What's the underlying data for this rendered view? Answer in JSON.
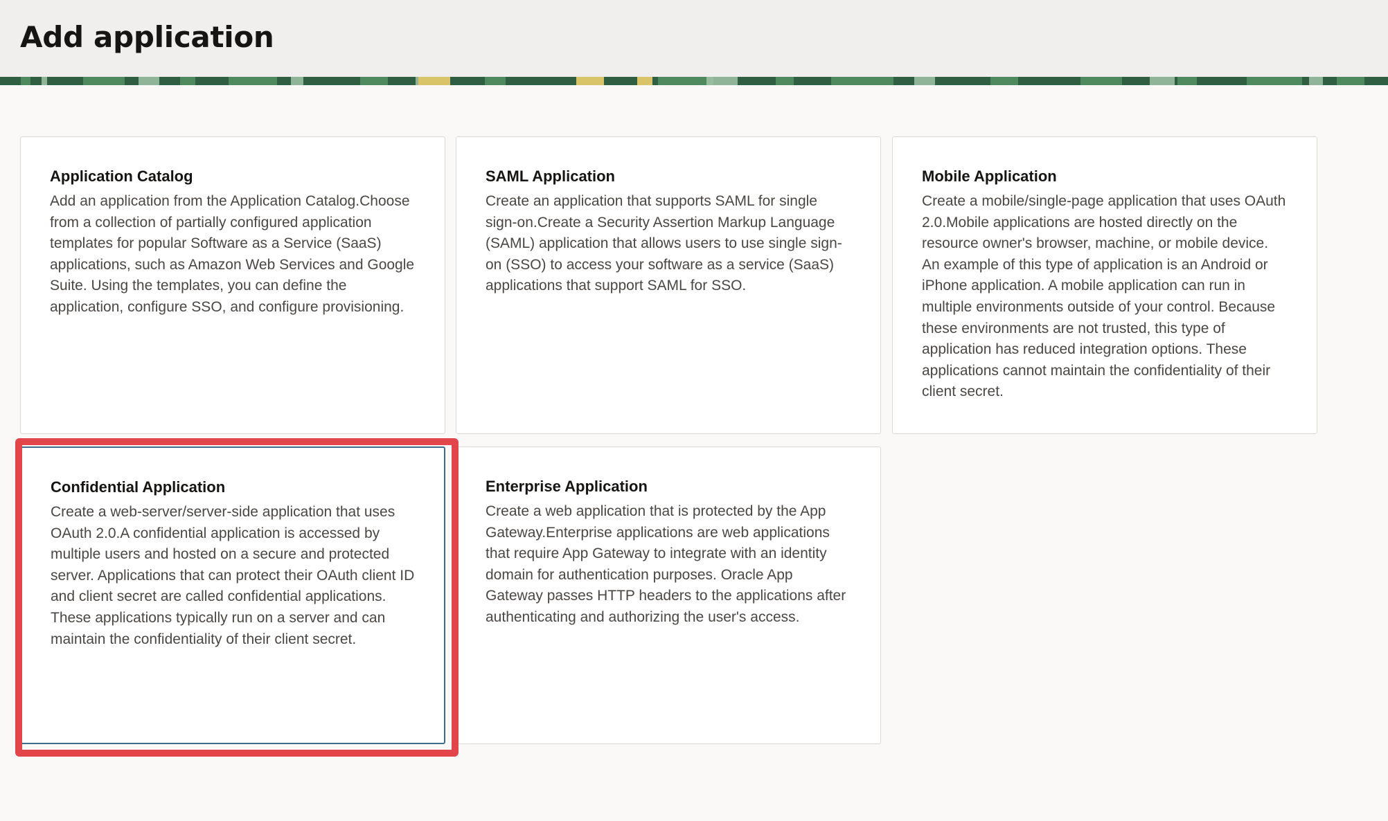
{
  "page": {
    "title": "Add application"
  },
  "colors": {
    "header_bg": "#f1efed",
    "page_bg": "#faf9f7",
    "card_border": "#dcd9d5",
    "selected_border": "#3c6e8a",
    "highlight": "#e2464b",
    "banner_green": "#2f5e43"
  },
  "cards": [
    {
      "title": "Application Catalog",
      "description": "Add an application from the Application Catalog.Choose from a collection of partially configured application templates for popular Software as a Service (SaaS) applications, such as Amazon Web Services and Google Suite. Using the templates, you can define the application, configure SSO, and configure provisioning."
    },
    {
      "title": "SAML Application",
      "description": "Create an application that supports SAML for single sign-on.Create a Security Assertion Markup Language (SAML) application that allows users to use single sign-on (SSO) to access your software as a service (SaaS) applications that support SAML for SSO."
    },
    {
      "title": "Mobile Application",
      "description": "Create a mobile/single-page application that uses OAuth 2.0.Mobile applications are hosted directly on the resource owner's browser, machine, or mobile device. An example of this type of application is an Android or iPhone application. A mobile application can run in multiple environments outside of your control. Because these environments are not trusted, this type of application has reduced integration options. These applications cannot maintain the confidentiality of their client secret."
    },
    {
      "title": "Confidential Application",
      "description": "Create a web-server/server-side application that uses OAuth 2.0.A confidential application is accessed by multiple users and hosted on a secure and protected server. Applications that can protect their OAuth client ID and client secret are called confidential applications. These applications typically run on a server and can maintain the confidentiality of their client secret."
    },
    {
      "title": "Enterprise Application",
      "description": "Create a web application that is protected by the App Gateway.Enterprise applications are web applications that require App Gateway to integrate with an identity domain for authentication purposes. Oracle App Gateway passes HTTP headers to the applications after authenticating and authorizing the user's access."
    }
  ]
}
